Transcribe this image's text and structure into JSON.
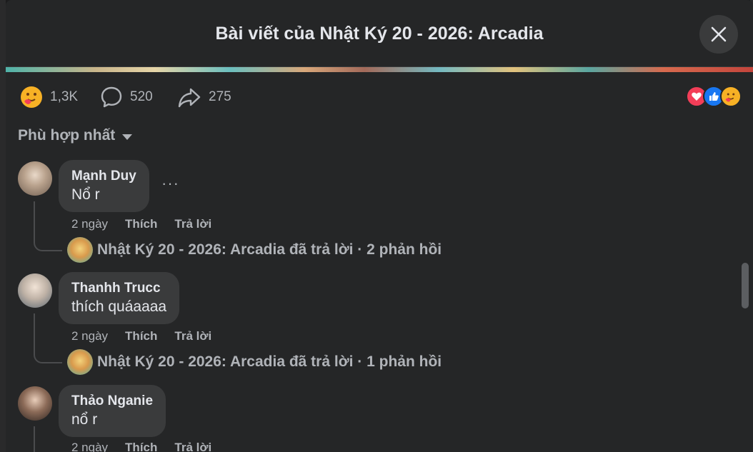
{
  "dialog": {
    "title": "Bài viết của Nhật Ký 20 - 2026: Arcadia"
  },
  "stats": {
    "reactions_count": "1,3K",
    "comments_count": "520",
    "shares_count": "275"
  },
  "sort": {
    "label": "Phù hợp nhất"
  },
  "colors": {
    "background": "#252627",
    "bubble": "#3a3b3c",
    "text_primary": "#e4e6eb",
    "text_secondary": "#b0b3b8",
    "love": "#f33e58",
    "like": "#1877f2",
    "care": "#f7b125"
  },
  "comments": [
    {
      "author": "Mạnh Duy",
      "text": "Nổ r",
      "time": "2 ngày",
      "like_label": "Thích",
      "reply_label": "Trả lời",
      "reply_summary": "Nhật Ký 20 - 2026: Arcadia đã trả lời · 2 phản hồi"
    },
    {
      "author": "Thanhh Trucc",
      "text": "thích quáaaaa",
      "time": "2 ngày",
      "like_label": "Thích",
      "reply_label": "Trả lời",
      "reply_summary": "Nhật Ký 20 - 2026: Arcadia đã trả lời · 1 phản hồi"
    },
    {
      "author": "Thảo Nganie",
      "text": "nổ r",
      "time": "2 ngày",
      "like_label": "Thích",
      "reply_label": "Trả lời"
    }
  ]
}
